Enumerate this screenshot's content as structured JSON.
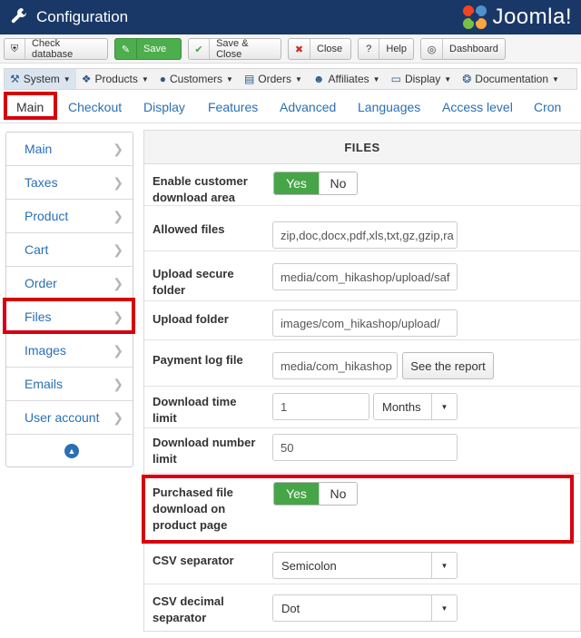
{
  "header": {
    "title": "Configuration",
    "logo_text": "Joomla!"
  },
  "toolbar": {
    "check_db": "Check database",
    "save": "Save",
    "save_close": "Save & Close",
    "close": "Close",
    "help": "Help",
    "dashboard": "Dashboard"
  },
  "menu": {
    "system": "System",
    "products": "Products",
    "customers": "Customers",
    "orders": "Orders",
    "affiliates": "Affiliates",
    "display": "Display",
    "documentation": "Documentation"
  },
  "tabs": [
    "Main",
    "Checkout",
    "Display",
    "Features",
    "Advanced",
    "Languages",
    "Access level",
    "Cron"
  ],
  "sidebar": {
    "items": [
      {
        "label": "Main"
      },
      {
        "label": "Taxes"
      },
      {
        "label": "Product"
      },
      {
        "label": "Cart"
      },
      {
        "label": "Order"
      },
      {
        "label": "Files"
      },
      {
        "label": "Images"
      },
      {
        "label": "Emails"
      },
      {
        "label": "User account"
      }
    ]
  },
  "panel": {
    "title": "FILES",
    "enable_download": {
      "label": "Enable customer download area",
      "yes": "Yes",
      "no": "No",
      "value": "Yes"
    },
    "allowed_files": {
      "label": "Allowed files",
      "value": "zip,doc,docx,pdf,xls,txt,gz,gzip,ra"
    },
    "upload_secure": {
      "label": "Upload secure folder",
      "value": "media/com_hikashop/upload/saf"
    },
    "upload_folder": {
      "label": "Upload folder",
      "value": "images/com_hikashop/upload/"
    },
    "payment_log": {
      "label": "Payment log file",
      "value": "media/com_hikashop",
      "button": "See the report"
    },
    "download_time": {
      "label": "Download time limit",
      "value": "1",
      "unit": "Months"
    },
    "download_number": {
      "label": "Download number limit",
      "value": "50"
    },
    "purchased_download": {
      "label": "Purchased file download on product page",
      "yes": "Yes",
      "no": "No",
      "value": "Yes"
    },
    "csv_separator": {
      "label": "CSV separator",
      "value": "Semicolon"
    },
    "csv_decimal": {
      "label": "CSV decimal separator",
      "value": "Dot"
    }
  },
  "colors": {
    "header_bg": "#1a3867",
    "link": "#2a6fb4",
    "highlight": "#d7000f",
    "toggle_on": "#46a546"
  }
}
